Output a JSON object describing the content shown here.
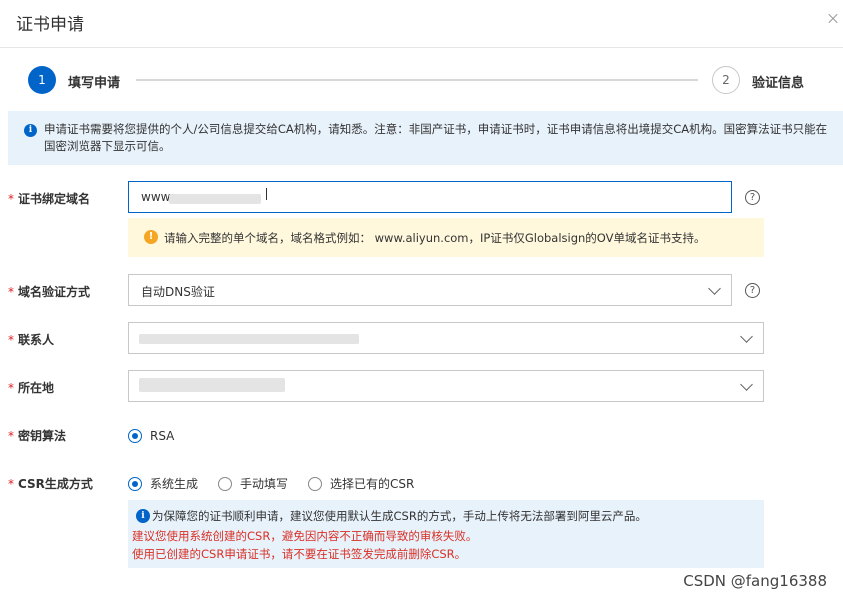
{
  "dialog": {
    "title": "证书申请"
  },
  "steps": [
    {
      "number": "1",
      "label": "填写申请"
    },
    {
      "number": "2",
      "label": "验证信息"
    }
  ],
  "notice": {
    "text": "申请证书需要将您提供的个人/公司信息提交给CA机构，请知悉。注意：非国产证书，申请证书时，证书申请信息将出境提交CA机构。国密算法证书只能在国密浏览器下显示可信。"
  },
  "form": {
    "domain": {
      "label": "证书绑定域名",
      "value_prefix": "www",
      "hint": "请输入完整的单个域名，域名格式例如： www.aliyun.com，IP证书仅Globalsign的OV单域名证书支持。"
    },
    "verify_method": {
      "label": "域名验证方式",
      "selected": "自动DNS验证"
    },
    "contact": {
      "label": "联系人"
    },
    "location": {
      "label": "所在地"
    },
    "key_algorithm": {
      "label": "密钥算法",
      "options": [
        "RSA"
      ],
      "selected": "RSA"
    },
    "csr": {
      "label": "CSR生成方式",
      "options": [
        "系统生成",
        "手动填写",
        "选择已有的CSR"
      ],
      "selected": "系统生成",
      "info": "为保障您的证书顺利申请，建议您使用默认生成CSR的方式，手动上传将无法部署到阿里云产品。",
      "warning1": "建议您使用系统创建的CSR，避免因内容不正确而导致的审核失败。",
      "warning2": "使用已创建的CSR申请证书，请不要在证书签发完成前删除CSR。"
    }
  },
  "watermark": "CSDN @fang16388"
}
